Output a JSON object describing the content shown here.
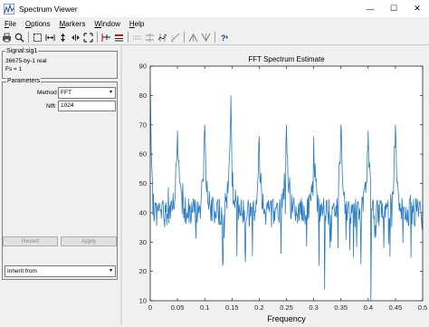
{
  "window": {
    "title": "Spectrum Viewer",
    "controls": {
      "minimize": "—",
      "maximize": "☐",
      "close": "✕"
    }
  },
  "menu": {
    "items": [
      {
        "key": "file",
        "label": "File",
        "mnemonic": "F",
        "rest": "ile"
      },
      {
        "key": "options",
        "label": "Options",
        "mnemonic": "O",
        "rest": "ptions"
      },
      {
        "key": "markers",
        "label": "Markers",
        "mnemonic": "M",
        "rest": "arkers"
      },
      {
        "key": "window",
        "label": "Window",
        "mnemonic": "W",
        "rest": "indow"
      },
      {
        "key": "help",
        "label": "Help",
        "mnemonic": "H",
        "rest": "elp"
      }
    ]
  },
  "toolbar": {
    "icons": [
      "print-icon",
      "zoom-in-icon",
      "select-box-icon",
      "zoom-x-icon",
      "zoom-y-icon",
      "expand-x-icon",
      "full-view-icon",
      "ruler-icon",
      "marker-list-icon",
      "vertical-markers-icon",
      "horizontal-markers-icon",
      "track-markers-icon",
      "slope-markers-icon",
      "peaks-icon",
      "valleys-icon",
      "help-icon"
    ]
  },
  "signal": {
    "title": "Signal:sig1",
    "size": "36675-by-1 real",
    "fs": "Fs = 1"
  },
  "parameters": {
    "title": "Parameters",
    "method_label": "Method",
    "method_value": "FFT",
    "nfft_label": "Nfft",
    "nfft_value": "1024",
    "inherit_value": "Inherit from",
    "revert_label": "Revert",
    "apply_label": "Apply"
  },
  "colors": {
    "line": "#2b7bc0",
    "menu_bg": "#f0f0f0",
    "titlebar_bg": "#ffffff"
  },
  "chart_data": {
    "type": "line",
    "title": "FFT Spectrum Estimate",
    "xlabel": "Frequency",
    "ylabel": "",
    "xlim": [
      0,
      0.5
    ],
    "ylim": [
      10,
      90
    ],
    "xticks": [
      "0",
      "0.05",
      "0.1",
      "0.15",
      "0.2",
      "0.25",
      "0.3",
      "0.35",
      "0.4",
      "0.45",
      "0.5"
    ],
    "yticks": [
      "10",
      "20",
      "30",
      "40",
      "50",
      "60",
      "70",
      "80",
      "90"
    ],
    "grid": false,
    "peaks": [
      {
        "x": 0.0,
        "y": 84
      },
      {
        "x": 0.05,
        "y": 68
      },
      {
        "x": 0.1,
        "y": 70
      },
      {
        "x": 0.148,
        "y": 80
      },
      {
        "x": 0.2,
        "y": 66
      },
      {
        "x": 0.25,
        "y": 70
      },
      {
        "x": 0.3,
        "y": 66
      },
      {
        "x": 0.35,
        "y": 70
      },
      {
        "x": 0.4,
        "y": 68
      },
      {
        "x": 0.45,
        "y": 70
      }
    ],
    "noise_floor": 40,
    "series": [
      {
        "color": "#2b7bc0"
      }
    ]
  }
}
